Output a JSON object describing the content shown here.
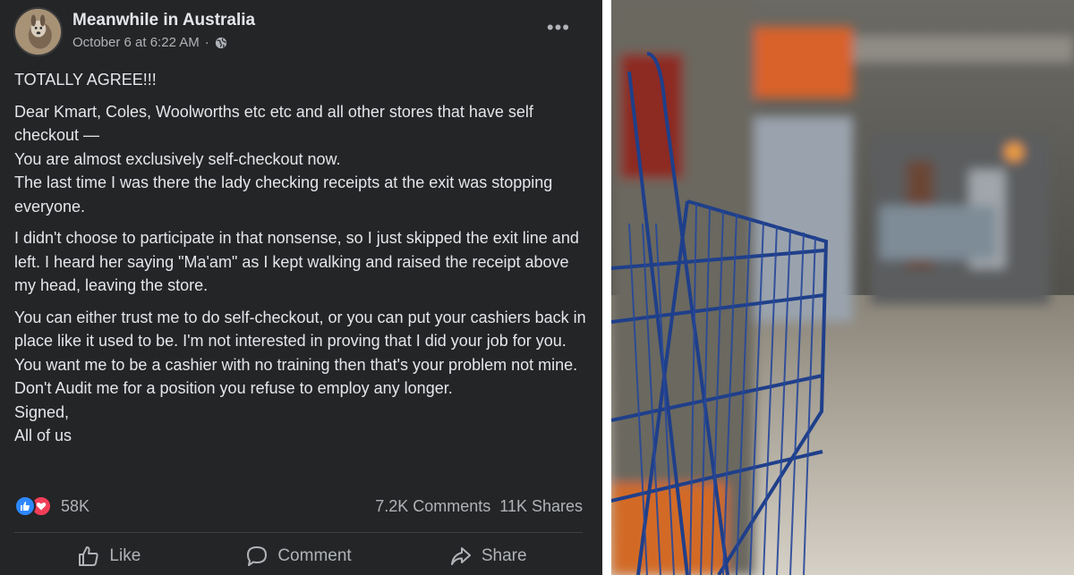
{
  "post": {
    "author": "Meanwhile in Australia",
    "timestamp": "October 6 at 6:22 AM",
    "separator": "·",
    "privacy_icon": "globe-icon",
    "more_label": "•••",
    "paragraphs": [
      "TOTALLY AGREE!!!",
      "Dear Kmart, Coles, Woolworths etc etc and all other stores that have self checkout —\nYou are almost exclusively self-checkout now.\nThe last time I was there the lady checking receipts at the exit was stopping everyone.",
      "I didn't choose to participate in that nonsense, so I just skipped the exit line and left. I heard her saying \"Ma'am\" as I kept walking and raised the receipt above my head, leaving the store.",
      "You can either trust me to do self-checkout, or you can put your cashiers back in place like it used to be. I'm not interested in proving that I did your job for you. You want me to be a cashier with no training then that's your problem not mine. Don't Audit me for a position you refuse to employ any longer.\nSigned,\nAll of us"
    ],
    "reactions_count": "58K",
    "comments": "7.2K Comments",
    "shares": "11K Shares",
    "actions": {
      "like": "Like",
      "comment": "Comment",
      "share": "Share"
    }
  },
  "colors": {
    "post_bg": "#242526",
    "text": "#e4e6eb",
    "secondary": "#b0b3b8",
    "like_blue": "#2d88ff",
    "love_red": "#f33e58"
  }
}
